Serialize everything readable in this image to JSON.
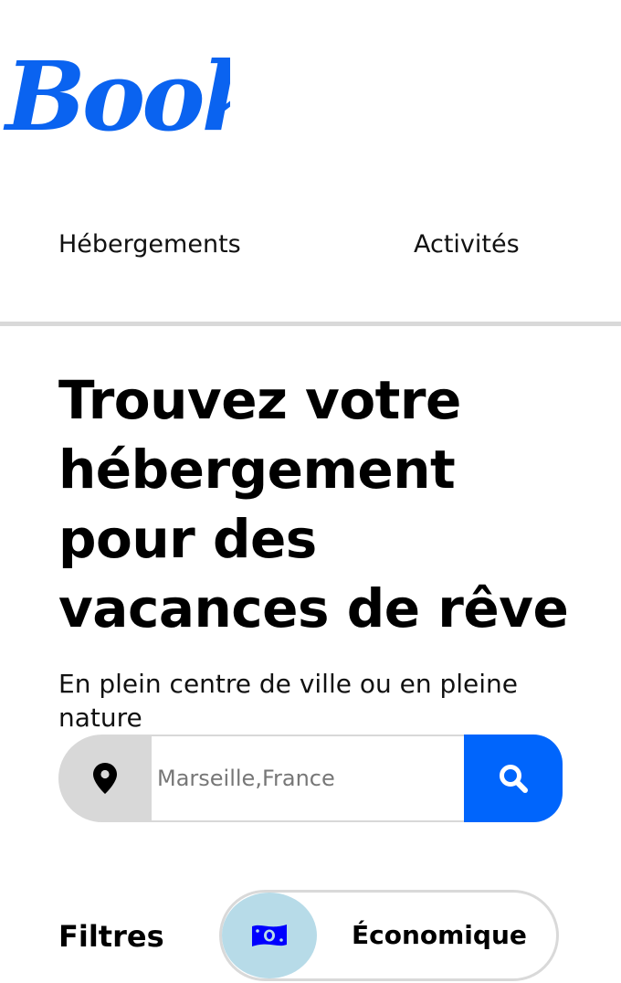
{
  "logo": {
    "text": "Booki",
    "color": "#0065fc"
  },
  "nav": {
    "items": [
      {
        "label": "Hébergements"
      },
      {
        "label": "Activités"
      }
    ]
  },
  "hero": {
    "title_lines": [
      "Trouvez votre",
      "hébergement",
      "pour des",
      "vacances de rêve"
    ],
    "subtitle": "En plein centre de ville ou en pleine nature"
  },
  "search": {
    "placeholder": "Marseille,France",
    "pin_icon": "map-pin-icon",
    "button_icon": "search-icon",
    "button_color": "#0065fc"
  },
  "filters": {
    "label": "Filtres",
    "options": [
      {
        "label": "Économique",
        "icon": "money-bill-icon",
        "icon_bg": "#b7dbe8",
        "icon_color": "#0000ff"
      }
    ]
  }
}
